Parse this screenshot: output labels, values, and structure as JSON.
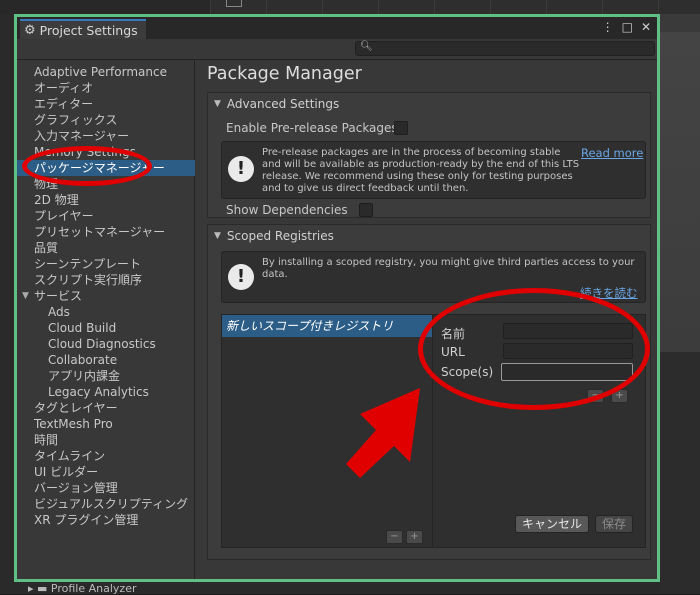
{
  "window": {
    "title": "Project Settings",
    "controls": [
      "⋮",
      "□",
      "✕"
    ]
  },
  "sidebar": {
    "items": [
      {
        "label": "Adaptive Performance"
      },
      {
        "label": "オーディオ"
      },
      {
        "label": "エディター"
      },
      {
        "label": "グラフィックス"
      },
      {
        "label": "入力マネージャー"
      },
      {
        "label": "Memory Settings"
      },
      {
        "label": "パッケージマネージャー"
      },
      {
        "label": "物理"
      },
      {
        "label": "2D 物理"
      },
      {
        "label": "プレイヤー"
      },
      {
        "label": "プリセットマネージャー"
      },
      {
        "label": "品質"
      },
      {
        "label": "シーンテンプレート"
      },
      {
        "label": "スクリプト実行順序"
      },
      {
        "label": "サービス"
      },
      {
        "label": "Ads"
      },
      {
        "label": "Cloud Build"
      },
      {
        "label": "Cloud Diagnostics"
      },
      {
        "label": "Collaborate"
      },
      {
        "label": "アプリ内課金"
      },
      {
        "label": "Legacy Analytics"
      },
      {
        "label": "タグとレイヤー"
      },
      {
        "label": "TextMesh Pro"
      },
      {
        "label": "時間"
      },
      {
        "label": "タイムライン"
      },
      {
        "label": "UI ビルダー"
      },
      {
        "label": "バージョン管理"
      },
      {
        "label": "ビジュアルスクリプティング"
      },
      {
        "label": "XR プラグイン管理"
      }
    ]
  },
  "main": {
    "title": "Package Manager",
    "advanced": {
      "header": "Advanced Settings",
      "prerelease_label": "Enable Pre-release Packages",
      "help_text": "Pre-release packages are in the process of becoming stable and will be available as production-ready by the end of this LTS release. We recommend using these only for testing purposes and to give us direct feedback until then.",
      "read_more": "Read more",
      "show_deps_label": "Show Dependencies"
    },
    "scoped": {
      "header": "Scoped Registries",
      "help_text": "By installing a scoped registry, you might give third parties access to your data.",
      "read_more": "続きを読む",
      "list_item": "新しいスコープ付きレジストリ",
      "name_label": "名前",
      "url_label": "URL",
      "scope_label": "Scope(s)",
      "cancel": "キャンセル",
      "save": "保存"
    }
  },
  "bottom": {
    "folder": "Profile Analyzer"
  },
  "colors": {
    "selection": "#2c5d87",
    "window_border": "#5fbf85",
    "annotation": "#e00000",
    "link": "#6aa6e6"
  }
}
